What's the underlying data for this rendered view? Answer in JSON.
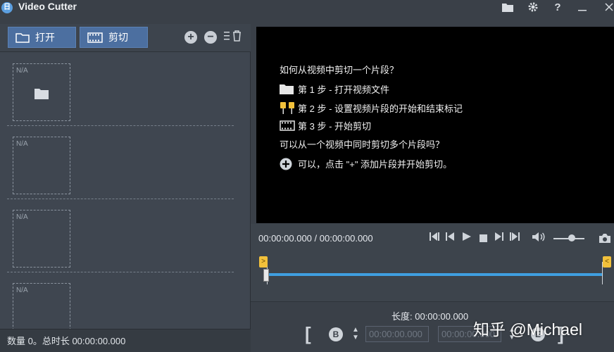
{
  "window": {
    "title": "Video Cutter",
    "icon_letter": "日",
    "controls": [
      "folder-icon",
      "gear-icon",
      "help-icon",
      "minimize-icon",
      "close-icon"
    ]
  },
  "toolbar": {
    "open_label": "打开",
    "cut_label": "剪切"
  },
  "clips": [
    {
      "thumb_label": "N/A"
    },
    {
      "thumb_label": "N/A"
    },
    {
      "thumb_label": "N/A"
    },
    {
      "thumb_label": "N/A"
    }
  ],
  "status": {
    "summary": "数量 0。总时长 00:00:00.000"
  },
  "guide": {
    "heading": "如何从视频中剪切一个片段？",
    "step1": "第 1 步 - 打开视频文件",
    "step2": "第 2 步 - 设置视频片段的开始和结束标记",
    "step3": "第 3 步 - 开始剪切",
    "question2": "可以从一个视频中同时剪切多个片段吗？",
    "answer2": "可以，点击 \"+\" 添加片段并开始剪切。"
  },
  "player": {
    "timecode": "00:00:00.000 / 00:00:00.000",
    "marker_label": ">",
    "marker_end_label": "<"
  },
  "segment": {
    "length_label": "长度: 00:00:00.000",
    "start_label": "B",
    "end_label": "E",
    "start_time": "00:00:00.000",
    "end_time": "00:00:00.000"
  },
  "watermark": "知乎 @Michael",
  "colors": {
    "accent": "#4c6fa0",
    "timeline": "#3f9fe0",
    "marker": "#f2c13b"
  }
}
